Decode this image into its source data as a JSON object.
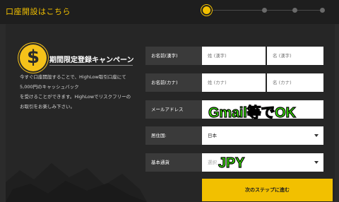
{
  "header": {
    "title": "口座開設はこちら",
    "steps": [
      {
        "icon": "step-dot-icon",
        "active": true
      },
      {
        "icon": "step-dot-icon",
        "active": false
      },
      {
        "icon": "step-dot-icon",
        "active": false
      },
      {
        "icon": "step-dot-icon",
        "active": false
      }
    ]
  },
  "promo": {
    "icon": "dollar-coin-icon",
    "icon_glyph": "$",
    "title": "期間限定登録キャンペーン",
    "description_lines": [
      "今すぐ口座開設することで、HighLow取引口座にて",
      "5,000円のキャッシュバック",
      "を受けることができます。HighLowでリスクフリーの",
      "お取引をお楽しみ下さい。"
    ]
  },
  "form": {
    "name_kanji": {
      "label": "お名前(漢字)",
      "last_placeholder": "姓 (漢字)",
      "first_placeholder": "名 (漢字)"
    },
    "name_kana": {
      "label": "お名前(カナ)",
      "last_placeholder": "姓 (カナ)",
      "first_placeholder": "名 (カナ)"
    },
    "email": {
      "label": "メールアドレス",
      "value": "",
      "overlay": "Gmail等でOK"
    },
    "country": {
      "label": "居住国:",
      "value": "日本"
    },
    "currency": {
      "label": "基本通貨",
      "value": "選択",
      "overlay": "JPY"
    },
    "submit_label": "次のステップに進む"
  },
  "colors": {
    "accent": "#f2c000",
    "panel": "#262626",
    "overlay_green": "#3cf000"
  }
}
